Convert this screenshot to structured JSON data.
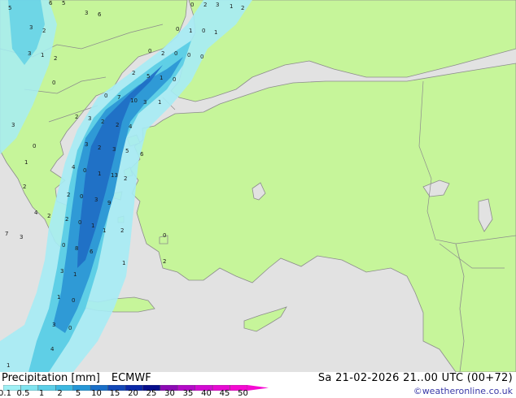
{
  "header": {
    "product": "Precipitation [mm]",
    "model": "ECMWF",
    "datetime": "Sa 21-02-2026 21..00 UTC (00+72)",
    "credit": "©weatheronline.co.uk"
  },
  "legend": {
    "labels": [
      "0.1",
      "0.5",
      "1",
      "2",
      "5",
      "10",
      "15",
      "20",
      "25",
      "30",
      "35",
      "40",
      "45",
      "50"
    ],
    "colors": [
      "#a0f0f5",
      "#80e4f0",
      "#5ccfe8",
      "#3cb8e0",
      "#2596d6",
      "#1a6fc8",
      "#1248b8",
      "#0a28a8",
      "#060e8c",
      "#8c0ab4",
      "#b40ac8",
      "#d20ad2",
      "#e60ad2",
      "#f50ad2"
    ]
  },
  "map": {
    "colors": {
      "land": "#c6f59a",
      "sea": "#e2e2e2",
      "border": "#8c8c8c",
      "rain_light": "#a6ecf5",
      "rain_mid": "#5fcfe6",
      "rain_heavy": "#2f9ad6",
      "rain_core": "#1f6dc4"
    },
    "rain_labels": [
      "0",
      "2",
      "3",
      "1",
      "2",
      "0",
      "1",
      "0",
      "1",
      "0",
      "2",
      "0",
      "0",
      "0",
      "3",
      "2",
      "3",
      "1",
      "2",
      "3",
      "6",
      "6",
      "5",
      "5",
      "2",
      "5",
      "1",
      "0",
      "7",
      "10",
      "3",
      "1",
      "0",
      "2",
      "3",
      "2",
      "2",
      "4",
      "3",
      "2",
      "3",
      "5",
      "6",
      "4",
      "0",
      "1",
      "13",
      "2",
      "2",
      "0",
      "3",
      "9",
      "2",
      "0",
      "1",
      "1",
      "2",
      "0",
      "8",
      "6",
      "3",
      "1",
      "1",
      "0",
      "3",
      "0",
      "4",
      "7",
      "3",
      "4",
      "2",
      "2",
      "3",
      "0",
      "1",
      "0",
      "0",
      "2",
      "1",
      "1"
    ]
  }
}
